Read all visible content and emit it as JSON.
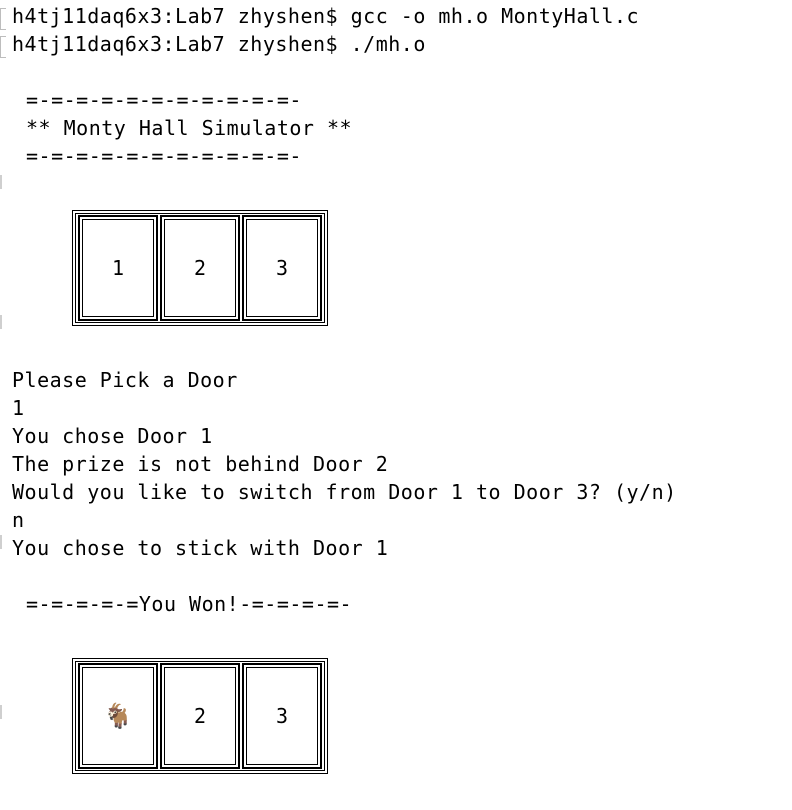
{
  "terminal": {
    "prompt1": "h4tj11daq6x3:Lab7 zhyshen$ gcc -o mh.o MontyHall.c",
    "prompt2": "h4tj11daq6x3:Lab7 zhyshen$ ./mh.o",
    "banner_rule_top": "=-=-=-=-=-=-=-=-=-=-=-",
    "banner_title": "** Monty Hall Simulator **",
    "banner_rule_bottom": "=-=-=-=-=-=-=-=-=-=-=-",
    "doors_before": [
      "1",
      "2",
      "3"
    ],
    "pick_prompt": "Please Pick a Door",
    "pick_input": "1",
    "chose": "You chose Door 1",
    "reveal": "The prize is not behind Door 2",
    "switch_prompt": "Would you like to switch from Door 1 to Door 3? (y/n)",
    "switch_input": "n",
    "stick": "You chose to stick with Door 1",
    "result_banner": "=-=-=-=-=You Won!-=-=-=-=-",
    "doors_after": [
      "🐐",
      "2",
      "3"
    ]
  }
}
